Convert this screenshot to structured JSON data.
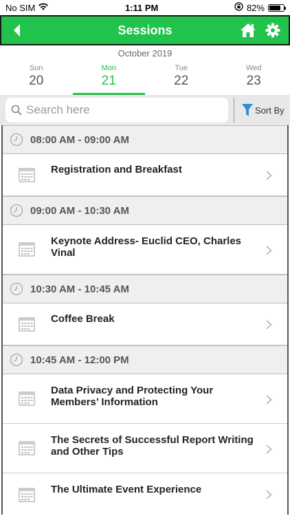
{
  "status_bar": {
    "carrier": "No SIM",
    "time": "1:11 PM",
    "battery": "82%",
    "battery_level": 0.82
  },
  "header": {
    "title": "Sessions"
  },
  "calendar": {
    "month": "October 2019",
    "days": [
      {
        "name": "Sun",
        "num": "20"
      },
      {
        "name": "Mon",
        "num": "21"
      },
      {
        "name": "Tue",
        "num": "22"
      },
      {
        "name": "Wed",
        "num": "23"
      }
    ],
    "selected": "Mon"
  },
  "search": {
    "placeholder": "Search here",
    "value": ""
  },
  "sort": {
    "label": "Sort By"
  },
  "groups": [
    {
      "time": "08:00 AM - 09:00 AM",
      "sessions": [
        "Registration and Breakfast"
      ]
    },
    {
      "time": "09:00 AM - 10:30 AM",
      "sessions": [
        "Keynote Address- Euclid CEO, Charles Vinal"
      ]
    },
    {
      "time": "10:30 AM - 10:45 AM",
      "sessions": [
        "Coffee Break"
      ]
    },
    {
      "time": "10:45 AM - 12:00 PM",
      "sessions": [
        "Data Privacy and Protecting Your Members’ Information",
        "The Secrets of Successful Report Writing and Other Tips",
        "The Ultimate Event Experience"
      ]
    }
  ],
  "colors": {
    "brand_green": "#22c34c",
    "header_text": "#ffffff",
    "time_header_bg": "#efefef"
  },
  "icons": [
    "back-arrow-icon",
    "home-icon",
    "gear-icon",
    "search-icon",
    "filter-icon",
    "clock-icon",
    "calendar-icon",
    "chevron-right-icon",
    "wifi-icon",
    "lock-rotation-icon",
    "battery-icon"
  ]
}
